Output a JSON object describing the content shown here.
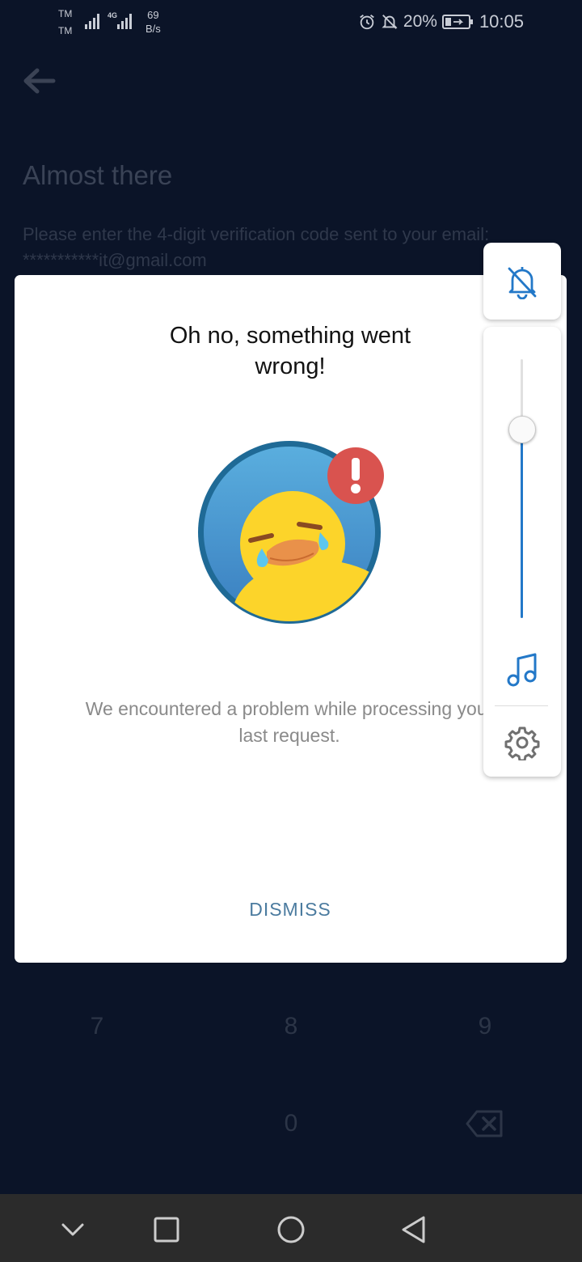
{
  "status_bar": {
    "carrier_1": "TM",
    "carrier_2": "TM",
    "network_type": "4G",
    "speed_value": "69",
    "speed_unit": "B/s",
    "battery": "20%",
    "time": "10:05"
  },
  "background_page": {
    "title": "Almost there",
    "instruction": "Please enter the 4-digit verification code sent to your email: ***********it@gmail.com",
    "keypad": [
      "7",
      "8",
      "9",
      "0"
    ]
  },
  "dialog": {
    "title": "Oh no, something went wrong!",
    "message": "We encountered a problem while processing your last request.",
    "dismiss_label": "DISMISS"
  },
  "volume_panel": {
    "level": 0.73,
    "accent_color": "#2378c8",
    "icons": [
      "bell-off-icon",
      "music-note-icon",
      "gear-icon"
    ]
  },
  "nav_bar": {
    "icons": [
      "chevron-down-icon",
      "recents-square-icon",
      "home-circle-icon",
      "back-triangle-icon"
    ]
  }
}
